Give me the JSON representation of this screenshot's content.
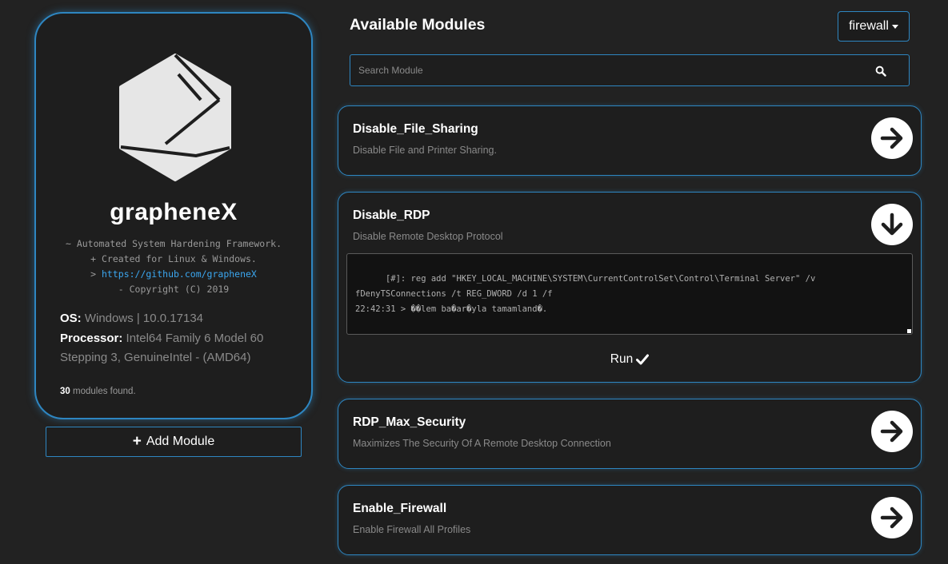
{
  "app": {
    "name": "grapheneX",
    "tagline_1": "~ Automated System Hardening Framework.",
    "tagline_2": "+ Created for Linux & Windows.",
    "link_prefix": ">",
    "link": "https://github.com/grapheneX",
    "copyright": "- Copyright (C) 2019"
  },
  "system": {
    "os_label": "OS:",
    "os_value": "Windows | 10.0.17134",
    "proc_label": "Processor:",
    "proc_value": "Intel64 Family 6 Model 60 Stepping 3, GenuineIntel - (AMD64)"
  },
  "modules_count": "30",
  "modules_found_text": "modules found.",
  "add_module_label": "Add Module",
  "header": {
    "title": "Available Modules",
    "category": "firewall"
  },
  "search": {
    "placeholder": "Search Module"
  },
  "modules": [
    {
      "name": "Disable_File_Sharing",
      "desc": "Disable File and Printer Sharing.",
      "state": "collapsed"
    },
    {
      "name": "Disable_RDP",
      "desc": "Disable Remote Desktop Protocol",
      "state": "expanded",
      "output": "[#]: reg add \"HKEY_LOCAL_MACHINE\\SYSTEM\\CurrentControlSet\\Control\\Terminal Server\" /v fDenyTSConnections /t REG_DWORD /d 1 /f\n22:42:31 > ��lem ba�ar�yla tamamland�.",
      "run_label": "Run"
    },
    {
      "name": "RDP_Max_Security",
      "desc": "Maximizes The Security Of A Remote Desktop Connection",
      "state": "collapsed"
    },
    {
      "name": "Enable_Firewall",
      "desc": "Enable Firewall All Profiles",
      "state": "collapsed"
    }
  ],
  "colors": {
    "accent": "#2e86c1",
    "background": "#222222",
    "card": "#1e1e1e",
    "link": "#3ba7f0"
  },
  "icons": {
    "logo": "graphene-hexagon-logo",
    "plus": "plus-icon",
    "caret": "caret-down-icon",
    "search": "search-icon",
    "arrow_right": "arrow-right-circle-icon",
    "arrow_down": "arrow-down-circle-icon",
    "check": "check-icon"
  }
}
